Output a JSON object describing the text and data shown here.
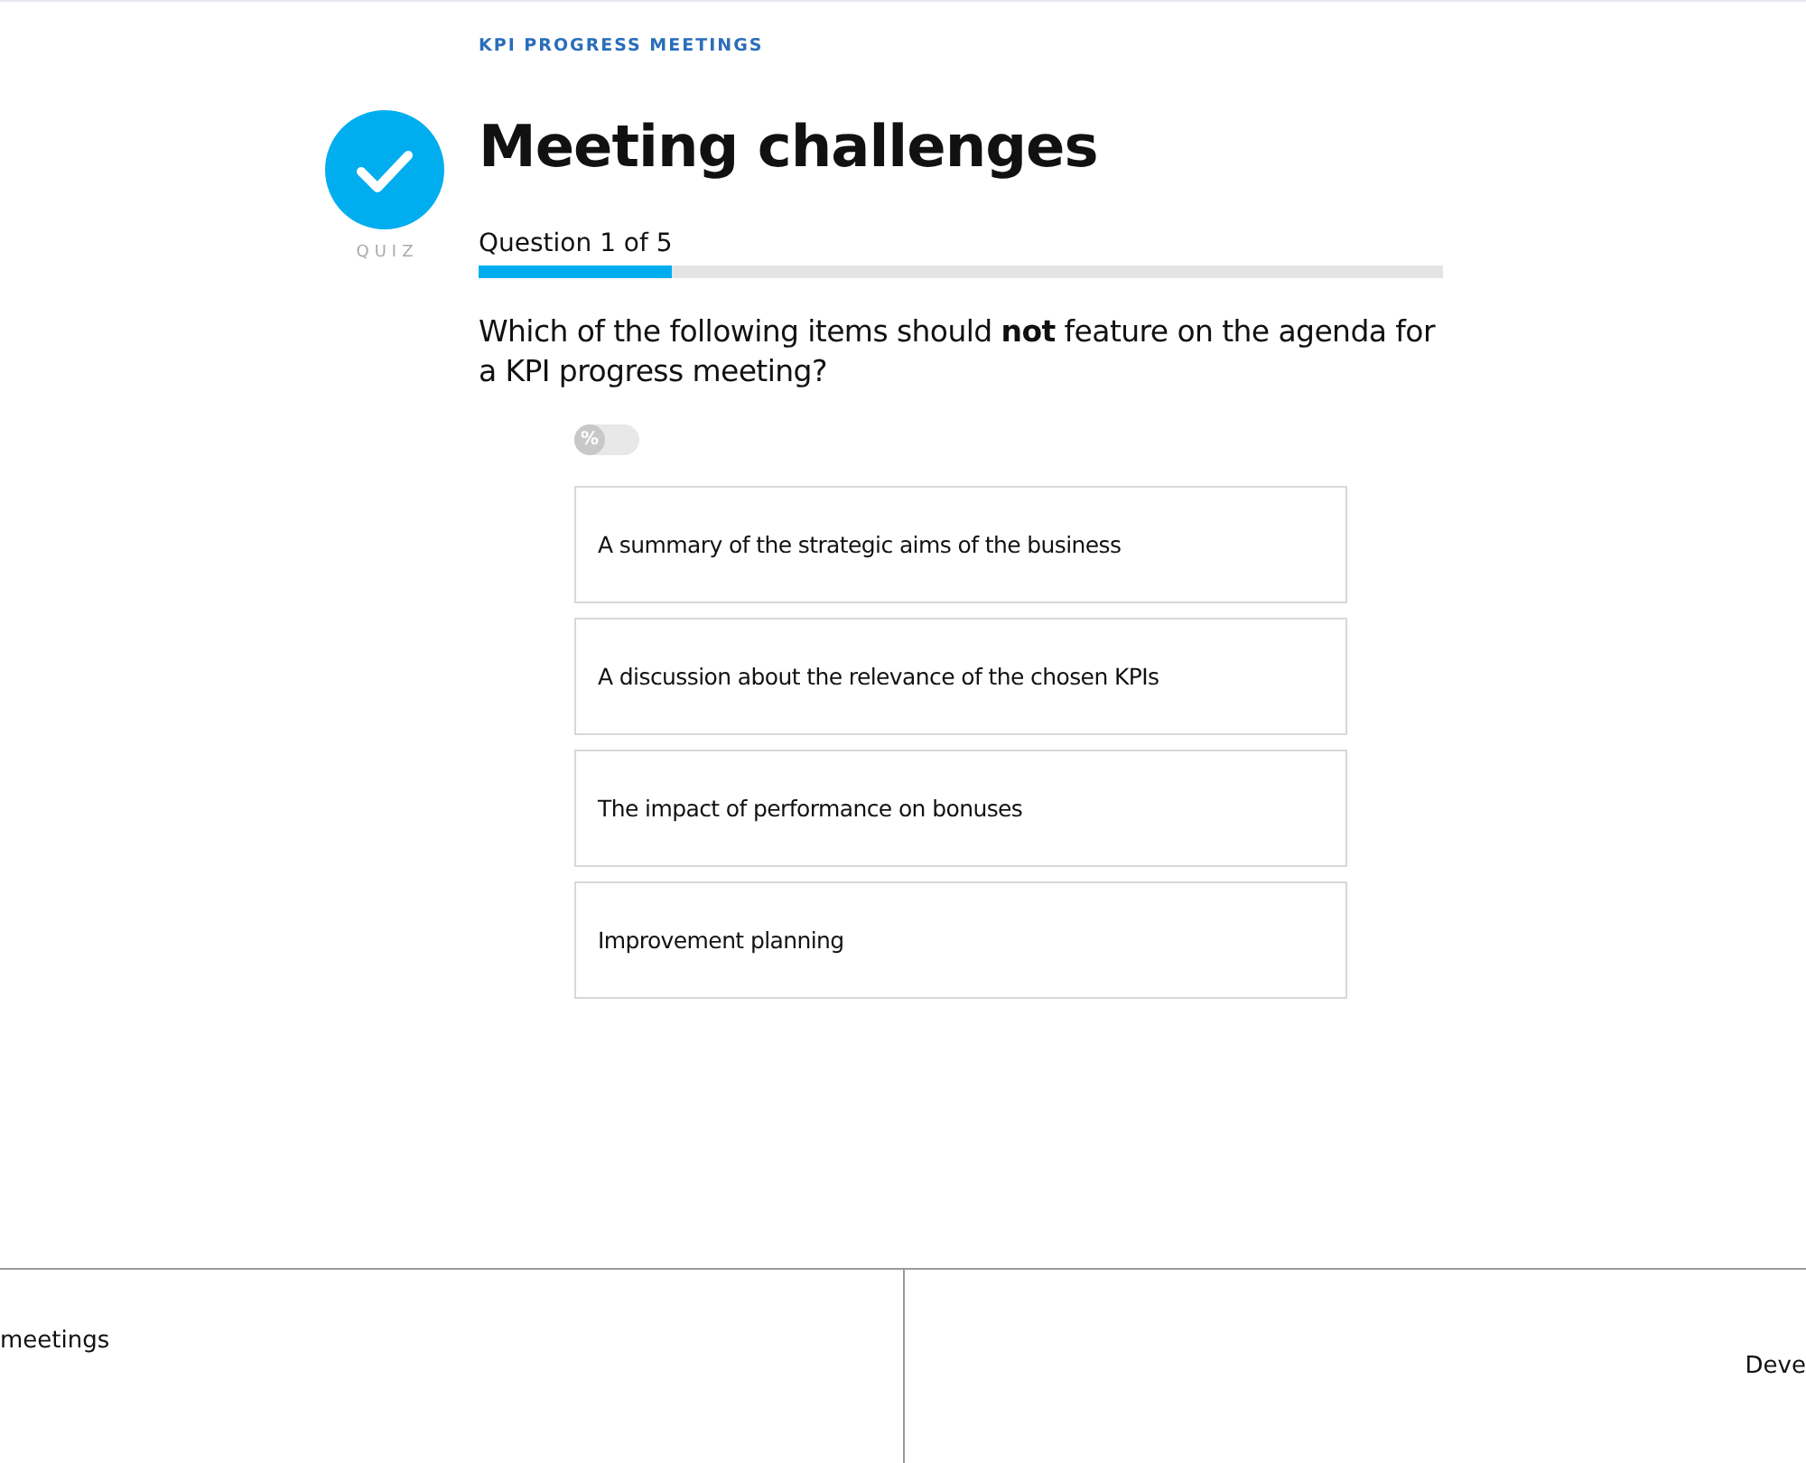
{
  "course": "KPI PROGRESS MEETINGS",
  "title": "Meeting challenges",
  "badge": "QUIZ",
  "progress": {
    "label": "Question 1 of 5",
    "level": 0.2
  },
  "question": "Which of the following items should **not** feature on the agenda for a KPI progress meeting?",
  "toggle": {
    "label": "%",
    "on": false
  },
  "options": [
    {
      "text": "A summary of the strategic aims of the business",
      "selected": false
    },
    {
      "text": "A discussion about the relevance of the chosen KPIs",
      "selected": false
    },
    {
      "text": "The impact of performance on bonuses",
      "selected": false
    },
    {
      "text": "Improvement planning",
      "selected": false
    }
  ],
  "footer": {
    "previous": "meetings",
    "next": "Deve"
  }
}
